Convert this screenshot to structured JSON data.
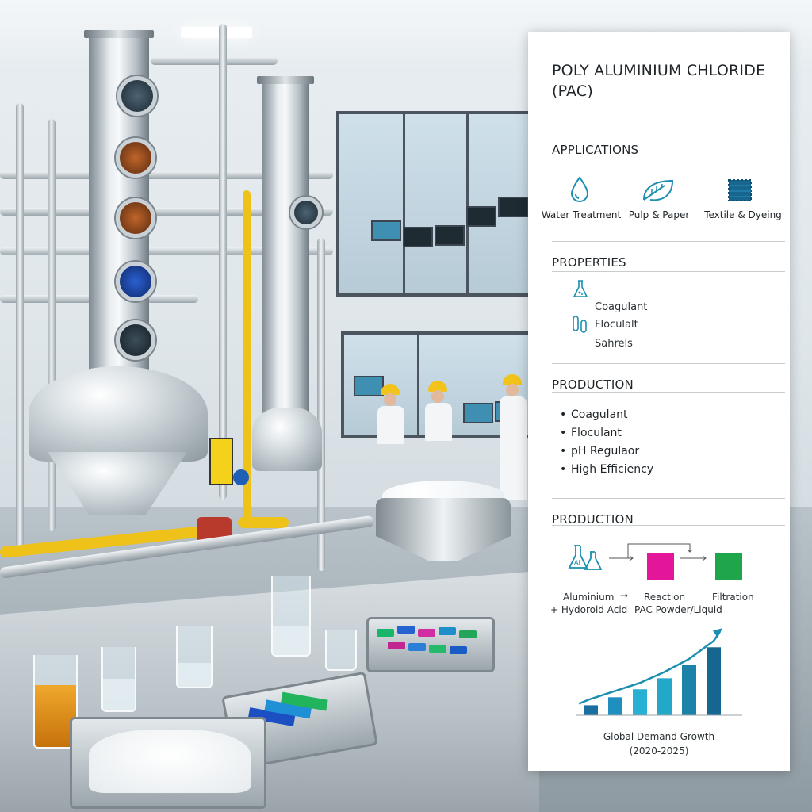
{
  "panel": {
    "title": "POLY ALUMINIUM CHLORIDE (PAC)",
    "applications": {
      "heading": "APPLICATIONS",
      "items": [
        {
          "label": "Water Treatment",
          "icon": "water-drop-icon"
        },
        {
          "label": "Pulp & Paper",
          "icon": "leaf-icon"
        },
        {
          "label": "Textile & Dyeing",
          "icon": "fabric-swatch-icon"
        }
      ]
    },
    "properties": {
      "heading": "PROPERTIES",
      "items": [
        "Coagulant",
        "Floculalt",
        "Sahrels"
      ]
    },
    "production_list": {
      "heading": "PRODUCTION",
      "items": [
        "Coagulant",
        "Floculant",
        "pH Regulaor",
        "High Efficiency"
      ]
    },
    "production_flow": {
      "heading": "PRODUCTION",
      "step_labels": [
        "Aluminium",
        "+ Hydoroid Acid",
        "→",
        "Reaction",
        "PAC Powder/Liquid",
        "Filtration"
      ],
      "colors": {
        "reaction": "#e3169a",
        "filtration": "#1fa64a",
        "accent": "#1b8fb0"
      }
    },
    "chart": {
      "caption_line1": "Global Demand Growth",
      "caption_line2": "(2020-2025)",
      "bar_colors": [
        "#1b6fa0",
        "#1f8fc0",
        "#27b0d3",
        "#23a8c9",
        "#1d82a8",
        "#176690"
      ]
    }
  },
  "chart_data": {
    "type": "bar",
    "title": "Global Demand Growth",
    "subtitle": "(2020-2025)",
    "values": [
      1.0,
      1.8,
      2.6,
      3.7,
      5.0,
      6.8
    ],
    "trend": "increasing",
    "grid": false
  }
}
